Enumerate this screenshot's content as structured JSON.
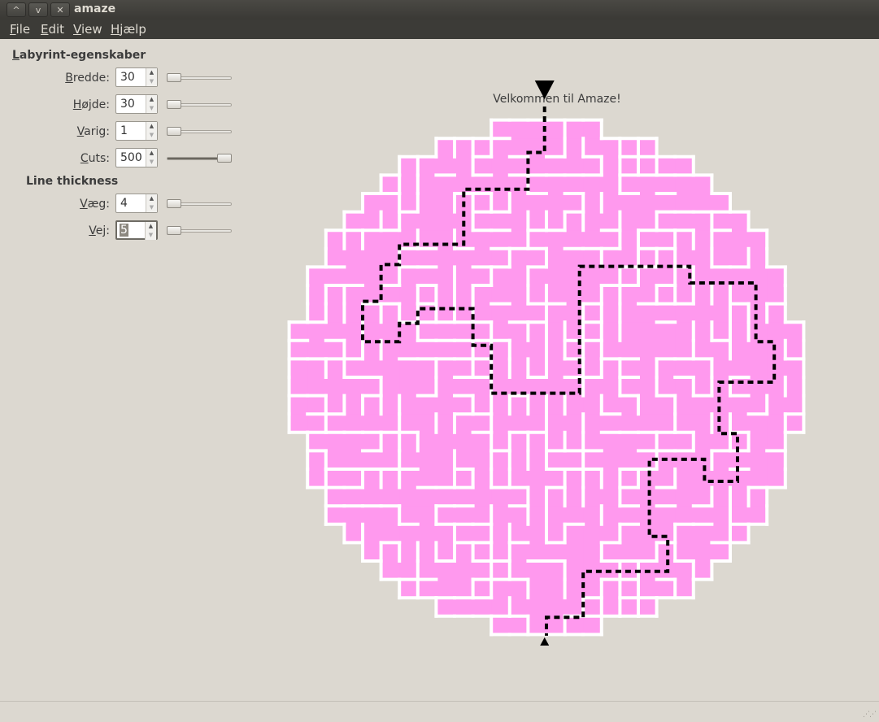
{
  "window": {
    "title": "amaze",
    "buttons": [
      {
        "name": "minimize-button",
        "glyph": "^"
      },
      {
        "name": "maximize-button",
        "glyph": "v"
      },
      {
        "name": "close-button",
        "glyph": "✕"
      }
    ]
  },
  "menu": {
    "items": [
      {
        "label": "File",
        "mnemonic": "F",
        "rest": "ile"
      },
      {
        "label": "Edit",
        "mnemonic": "E",
        "rest": "dit"
      },
      {
        "label": "View",
        "mnemonic": "V",
        "rest": "iew"
      },
      {
        "label": "Hjælp",
        "mnemonic": "H",
        "rest": "jælp"
      }
    ]
  },
  "properties": {
    "heading_mnemonic": "L",
    "heading_rest": "abyrint-egenskaber",
    "fields": [
      {
        "label_mnemonic": "B",
        "label_rest": "redde:",
        "value": "30",
        "fraction": 0.0
      },
      {
        "label_mnemonic": "H",
        "label_rest": "øjde:",
        "value": "30",
        "fraction": 0.0
      },
      {
        "label_mnemonic": "V",
        "label_rest": "arig:",
        "value": "1",
        "fraction": 0.0
      },
      {
        "label_mnemonic": "C",
        "label_rest": "uts:",
        "value": "500",
        "fraction": 1.0
      }
    ]
  },
  "thickness": {
    "heading": "Line thickness",
    "fields": [
      {
        "label_mnemonic": "V",
        "label_rest": "æg:",
        "value": "4",
        "fraction": 0.0
      },
      {
        "label_mnemonic": "V",
        "label_rest": "ej:",
        "value": "5",
        "fraction": 0.0
      }
    ]
  },
  "maze": {
    "welcome": "Velkommen til Amaze!",
    "fill_color": "#ff99ee",
    "wall_color": "#ffffff",
    "path_color": "#000000",
    "background_color": "#dcd8d0"
  }
}
